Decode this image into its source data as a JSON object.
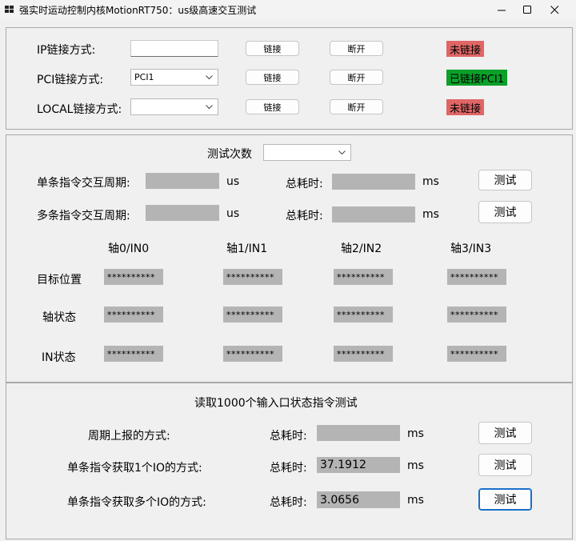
{
  "window": {
    "title": "强实时运动控制内核MotionRT750：us级高速交互测试"
  },
  "connection": {
    "ip": {
      "label": "IP链接方式:",
      "value": "",
      "connect_label": "链接",
      "disconnect_label": "断开",
      "status": "未链接",
      "status_color": "#e06666"
    },
    "pci": {
      "label": "PCI链接方式:",
      "selected": "PCI1",
      "connect_label": "链接",
      "disconnect_label": "断开",
      "status": "已链接PCI1",
      "status_color": "#0aa02a"
    },
    "local": {
      "label": "LOCAL链接方式:",
      "selected": "",
      "connect_label": "链接",
      "disconnect_label": "断开",
      "status": "未链接",
      "status_color": "#e06666"
    }
  },
  "interaction": {
    "test_count_label": "测试次数",
    "test_count_value": "",
    "single": {
      "label": "单条指令交互周期:",
      "value": "",
      "unit": "us",
      "total_label": "总耗时:",
      "total_value": "",
      "total_unit": "ms",
      "button": "测试"
    },
    "multi": {
      "label": "多条指令交互周期:",
      "value": "",
      "unit": "us",
      "total_label": "总耗时:",
      "total_value": "",
      "total_unit": "ms",
      "button": "测试"
    },
    "axis_headers": [
      "轴0/IN0",
      "轴1/IN1",
      "轴2/IN2",
      "轴3/IN3"
    ],
    "rows": [
      {
        "label": "目标位置",
        "values": [
          "**********",
          "**********",
          "**********",
          "**********"
        ]
      },
      {
        "label": "轴状态",
        "values": [
          "**********",
          "**********",
          "**********",
          "**********"
        ]
      },
      {
        "label": "IN状态",
        "values": [
          "**********",
          "**********",
          "**********",
          "**********"
        ]
      }
    ]
  },
  "io_test": {
    "title": "读取1000个输入口状态指令测试",
    "rows": [
      {
        "label": "周期上报的方式:",
        "total_label": "总耗时:",
        "value": "",
        "unit": "ms",
        "button": "测试"
      },
      {
        "label": "单条指令获取1个IO的方式:",
        "total_label": "总耗时:",
        "value": "37.1912",
        "unit": "ms",
        "button": "测试"
      },
      {
        "label": "单条指令获取多个IO的方式:",
        "total_label": "总耗时:",
        "value": "3.0656",
        "unit": "ms",
        "button": "测试"
      }
    ]
  }
}
